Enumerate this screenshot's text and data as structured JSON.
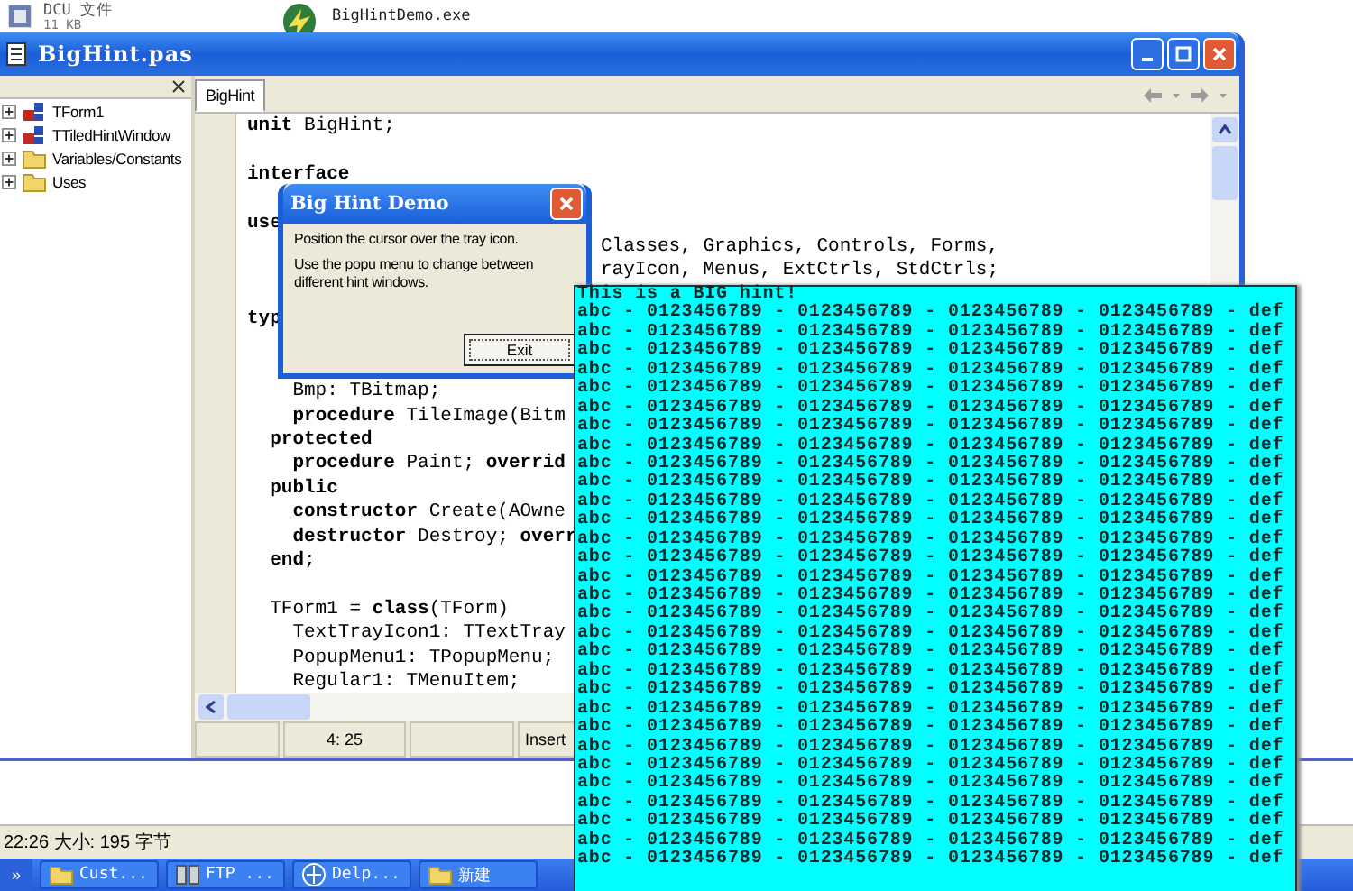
{
  "desktop_window": {
    "items": [
      {
        "name": "DCU 文件",
        "detail": "11 KB",
        "kind": "file"
      },
      {
        "name": "BigHintDemo.exe",
        "kind": "exe"
      }
    ]
  },
  "editor_window": {
    "title": "BigHint.pas",
    "tree": [
      {
        "label": "TForm1",
        "kind": "class",
        "expanded": false
      },
      {
        "label": "TTiledHintWindow",
        "kind": "class",
        "expanded": false
      },
      {
        "label": "Variables/Constants",
        "kind": "folder",
        "expanded": false
      },
      {
        "label": "Uses",
        "kind": "folder",
        "expanded": false
      }
    ],
    "tabs": [
      {
        "label": "BigHint",
        "selected": true
      }
    ],
    "code_lines": [
      {
        "left": "**unit** BigHint;"
      },
      {
        "kind": "blank"
      },
      {
        "left": "interface",
        "bold": true
      },
      {
        "kind": "blank"
      },
      {
        "left": "use",
        "bold": true
      },
      {
        "right": "Classes, Graphics, Controls, Forms,"
      },
      {
        "right": "rayIcon, Menus, ExtCtrls, StdCtrls;"
      },
      {
        "kind": "blank"
      },
      {
        "left": "typ",
        "bold": true
      },
      {
        "kind": "blank"
      },
      {
        "kind": "blank"
      },
      {
        "left": "    Bmp: TBitmap;"
      },
      {
        "left": "    **procedure** TileImage(Bitm"
      },
      {
        "left": "  protected",
        "bold": true
      },
      {
        "left": "    **procedure** Paint; **overrid**"
      },
      {
        "left": "  public",
        "bold": true
      },
      {
        "left": "    **constructor** Create(AOwne"
      },
      {
        "left": "    **destructor** Destroy; **overr**"
      },
      {
        "left": "  **end**;"
      },
      {
        "kind": "blank"
      },
      {
        "left": "  TForm1 = **class**(TForm)"
      },
      {
        "left": "    TextTrayIcon1: TTextTray"
      },
      {
        "left": "    PopupMenu1: TPopupMenu;"
      },
      {
        "left": "    Regular1: TMenuItem;"
      }
    ],
    "status": {
      "position": "4: 25",
      "mode": "Insert"
    }
  },
  "dialog": {
    "title": "Big Hint Demo",
    "messages": [
      "Position the cursor over the tray icon.",
      "Use the popu menu to change between different hint windows."
    ],
    "button": "Exit"
  },
  "hint": {
    "title": "This is a BIG hint!",
    "lines": [
      "abc - 0123456789 - 0123456789 - 0123456789 - 0123456789 - def",
      "abc - 0123456789 - 0123456789 - 0123456789 - 0123456789 - def",
      "abc - 0123456789 - 0123456789 - 0123456789 - 0123456789 - def",
      "abc - 0123456789 - 0123456789 - 0123456789 - 0123456789 - def",
      "abc - 0123456789 - 0123456789 - 0123456789 - 0123456789 - def",
      "abc - 0123456789 - 0123456789 - 0123456789 - 0123456789 - def",
      "abc - 0123456789 - 0123456789 - 0123456789 - 0123456789 - def",
      "abc - 0123456789 - 0123456789 - 0123456789 - 0123456789 - def",
      "abc - 0123456789 - 0123456789 - 0123456789 - 0123456789 - def",
      "abc - 0123456789 - 0123456789 - 0123456789 - 0123456789 - def",
      "abc - 0123456789 - 0123456789 - 0123456789 - 0123456789 - def",
      "abc - 0123456789 - 0123456789 - 0123456789 - 0123456789 - def",
      "abc - 0123456789 - 0123456789 - 0123456789 - 0123456789 - def",
      "abc - 0123456789 - 0123456789 - 0123456789 - 0123456789 - def",
      "abc - 0123456789 - 0123456789 - 0123456789 - 0123456789 - def",
      "abc - 0123456789 - 0123456789 - 0123456789 - 0123456789 - def",
      "abc - 0123456789 - 0123456789 - 0123456789 - 0123456789 - def",
      "abc - 0123456789 - 0123456789 - 0123456789 - 0123456789 - def",
      "abc - 0123456789 - 0123456789 - 0123456789 - 0123456789 - def",
      "abc - 0123456789 - 0123456789 - 0123456789 - 0123456789 - def",
      "abc - 0123456789 - 0123456789 - 0123456789 - 0123456789 - def",
      "abc - 0123456789 - 0123456789 - 0123456789 - 0123456789 - def",
      "abc - 0123456789 - 0123456789 - 0123456789 - 0123456789 - def",
      "abc - 0123456789 - 0123456789 - 0123456789 - 0123456789 - def",
      "abc - 0123456789 - 0123456789 - 0123456789 - 0123456789 - def",
      "abc - 0123456789 - 0123456789 - 0123456789 - 0123456789 - def",
      "abc - 0123456789 - 0123456789 - 0123456789 - 0123456789 - def",
      "abc - 0123456789 - 0123456789 - 0123456789 - 0123456789 - def",
      "abc - 0123456789 - 0123456789 - 0123456789 - 0123456789 - def",
      "abc - 0123456789 - 0123456789 - 0123456789 - 0123456789 - def"
    ]
  },
  "file_window": {
    "status": "22:26 大小: 195 字节"
  },
  "taskbar": {
    "start": "»",
    "buttons": [
      {
        "label": "Cust...",
        "kind": "folder"
      },
      {
        "label": "FTP ...",
        "kind": "ftp"
      },
      {
        "label": "Delp...",
        "kind": "delphi"
      },
      {
        "label": "新建",
        "kind": "folder"
      }
    ]
  }
}
